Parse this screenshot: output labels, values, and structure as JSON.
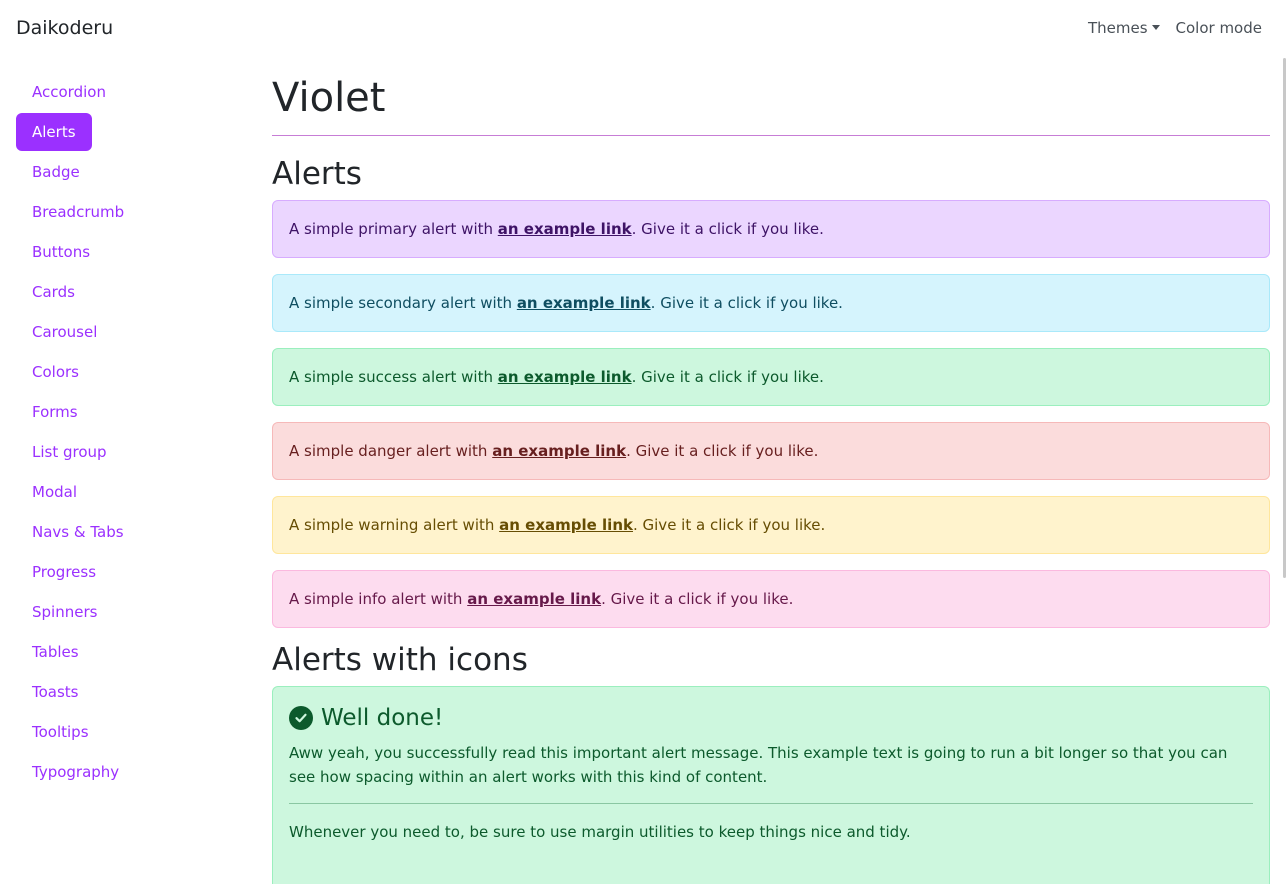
{
  "navbar": {
    "brand": "Daikoderu",
    "themes_label": "Themes",
    "color_mode_label": "Color mode"
  },
  "sidebar": {
    "items": [
      {
        "label": "Accordion"
      },
      {
        "label": "Alerts",
        "active": true
      },
      {
        "label": "Badge"
      },
      {
        "label": "Breadcrumb"
      },
      {
        "label": "Buttons"
      },
      {
        "label": "Cards"
      },
      {
        "label": "Carousel"
      },
      {
        "label": "Colors"
      },
      {
        "label": "Forms"
      },
      {
        "label": "List group"
      },
      {
        "label": "Modal"
      },
      {
        "label": "Navs & Tabs"
      },
      {
        "label": "Progress"
      },
      {
        "label": "Spinners"
      },
      {
        "label": "Tables"
      },
      {
        "label": "Toasts"
      },
      {
        "label": "Tooltips"
      },
      {
        "label": "Typography"
      }
    ]
  },
  "main": {
    "page_title": "Violet",
    "alerts_title": "Alerts",
    "alerts": [
      {
        "prefix": "A simple primary alert with ",
        "link": "an example link",
        "suffix": ". Give it a click if you like."
      },
      {
        "prefix": "A simple secondary alert with ",
        "link": "an example link",
        "suffix": ". Give it a click if you like."
      },
      {
        "prefix": "A simple success alert with ",
        "link": "an example link",
        "suffix": ". Give it a click if you like."
      },
      {
        "prefix": "A simple danger alert with ",
        "link": "an example link",
        "suffix": ". Give it a click if you like."
      },
      {
        "prefix": "A simple warning alert with ",
        "link": "an example link",
        "suffix": ". Give it a click if you like."
      },
      {
        "prefix": "A simple info alert with ",
        "link": "an example link",
        "suffix": ". Give it a click if you like."
      }
    ],
    "icons_title": "Alerts with icons",
    "icon_alert": {
      "icon": "check-circle-icon",
      "heading": "Well done!",
      "body": "Aww yeah, you successfully read this important alert message. This example text is going to run a bit longer so that you can see how spacing within an alert works with this kind of content.",
      "footer": "Whenever you need to, be sure to use margin utilities to keep things nice and tidy."
    }
  },
  "colors": {
    "accent": "#9b30ff",
    "primary_bg": "#ebd6ff",
    "secondary_bg": "#d5f4fd",
    "success_bg": "#cdf7de",
    "danger_bg": "#fbdcdc",
    "warning_bg": "#fff3cd",
    "info_bg": "#fddcef"
  }
}
